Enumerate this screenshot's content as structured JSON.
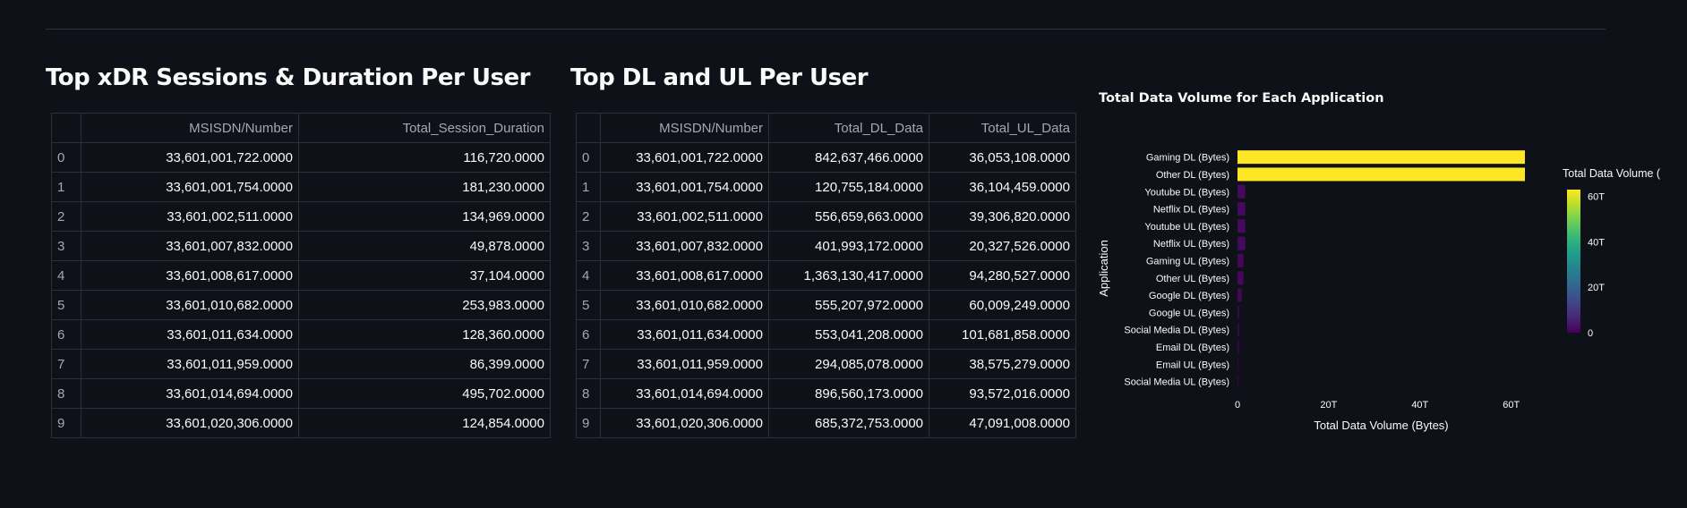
{
  "sessions": {
    "title": "Top xDR Sessions & Duration Per User",
    "columns": [
      "",
      "MSISDN/Number",
      "Total_Session_Duration"
    ],
    "rows": [
      [
        "0",
        "33,601,001,722.0000",
        "116,720.0000"
      ],
      [
        "1",
        "33,601,001,754.0000",
        "181,230.0000"
      ],
      [
        "2",
        "33,601,002,511.0000",
        "134,969.0000"
      ],
      [
        "3",
        "33,601,007,832.0000",
        "49,878.0000"
      ],
      [
        "4",
        "33,601,008,617.0000",
        "37,104.0000"
      ],
      [
        "5",
        "33,601,010,682.0000",
        "253,983.0000"
      ],
      [
        "6",
        "33,601,011,634.0000",
        "128,360.0000"
      ],
      [
        "7",
        "33,601,011,959.0000",
        "86,399.0000"
      ],
      [
        "8",
        "33,601,014,694.0000",
        "495,702.0000"
      ],
      [
        "9",
        "33,601,020,306.0000",
        "124,854.0000"
      ]
    ]
  },
  "dlul": {
    "title": "Top DL and UL Per User",
    "columns": [
      "",
      "MSISDN/Number",
      "Total_DL_Data",
      "Total_UL_Data"
    ],
    "rows": [
      [
        "0",
        "33,601,001,722.0000",
        "842,637,466.0000",
        "36,053,108.0000"
      ],
      [
        "1",
        "33,601,001,754.0000",
        "120,755,184.0000",
        "36,104,459.0000"
      ],
      [
        "2",
        "33,601,002,511.0000",
        "556,659,663.0000",
        "39,306,820.0000"
      ],
      [
        "3",
        "33,601,007,832.0000",
        "401,993,172.0000",
        "20,327,526.0000"
      ],
      [
        "4",
        "33,601,008,617.0000",
        "1,363,130,417.0000",
        "94,280,527.0000"
      ],
      [
        "5",
        "33,601,010,682.0000",
        "555,207,972.0000",
        "60,009,249.0000"
      ],
      [
        "6",
        "33,601,011,634.0000",
        "553,041,208.0000",
        "101,681,858.0000"
      ],
      [
        "7",
        "33,601,011,959.0000",
        "294,085,078.0000",
        "38,575,279.0000"
      ],
      [
        "8",
        "33,601,014,694.0000",
        "896,560,173.0000",
        "93,572,016.0000"
      ],
      [
        "9",
        "33,601,020,306.0000",
        "685,372,753.0000",
        "47,091,008.0000"
      ]
    ]
  },
  "chart_data": {
    "type": "bar",
    "orientation": "horizontal",
    "title": "Total Data Volume for Each Application",
    "xlabel": "Total Data Volume (Bytes)",
    "ylabel": "Application",
    "categories": [
      "Gaming DL (Bytes)",
      "Other DL (Bytes)",
      "Youtube DL (Bytes)",
      "Netflix DL (Bytes)",
      "Youtube UL (Bytes)",
      "Netflix UL (Bytes)",
      "Gaming UL (Bytes)",
      "Other UL (Bytes)",
      "Google DL (Bytes)",
      "Google UL (Bytes)",
      "Social Media DL (Bytes)",
      "Email DL (Bytes)",
      "Email UL (Bytes)",
      "Social Media UL (Bytes)"
    ],
    "values": [
      63000000000000.0,
      63000000000000.0,
      1700000000000.0,
      1700000000000.0,
      1700000000000.0,
      1700000000000.0,
      1300000000000.0,
      1300000000000.0,
      900000000000.0,
      350000000000.0,
      350000000000.0,
      300000000000.0,
      100000000000.0,
      50000000000.0
    ],
    "xlim": [
      0,
      63000000000000.0
    ],
    "xticks": [
      0,
      20000000000000.0,
      40000000000000.0,
      60000000000000.0
    ],
    "xtick_labels": [
      "0",
      "20T",
      "40T",
      "60T"
    ],
    "colorbar": {
      "title": "Total Data Volume (By",
      "range": [
        0,
        63000000000000.0
      ],
      "ticks": [
        0,
        20000000000000.0,
        40000000000000.0,
        60000000000000.0
      ],
      "tick_labels": [
        "0",
        "20T",
        "40T",
        "60T"
      ],
      "colorscale": "viridis"
    },
    "grid": false,
    "legend": "colorbar-right"
  }
}
